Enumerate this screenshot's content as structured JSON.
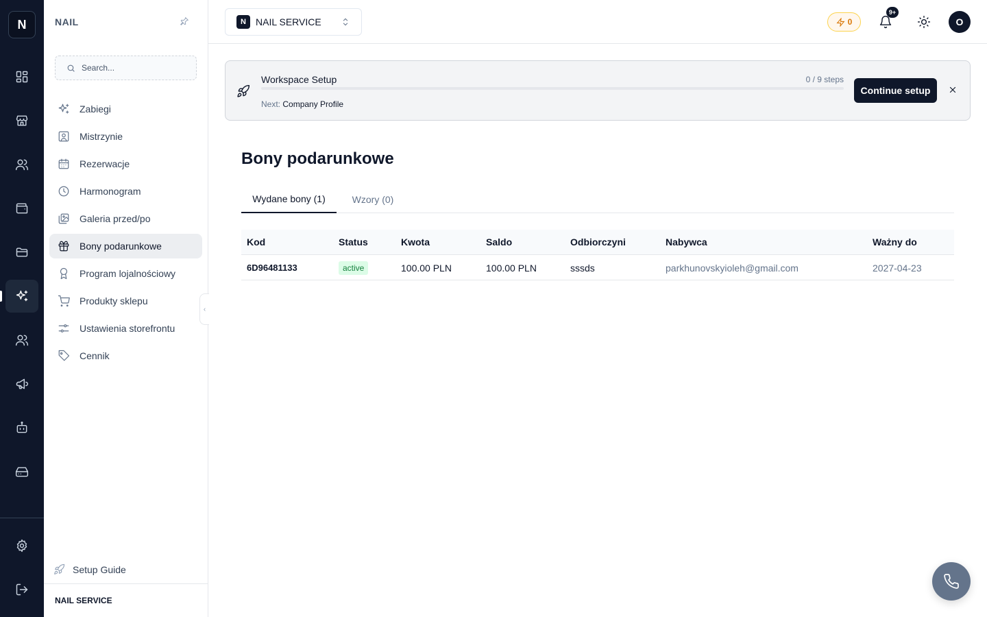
{
  "rail": {
    "logo": "N",
    "items": [
      {
        "icon": "dashboard-icon"
      },
      {
        "icon": "store-icon"
      },
      {
        "icon": "users-icon"
      },
      {
        "icon": "wallet-icon"
      },
      {
        "icon": "folder-icon"
      },
      {
        "icon": "sparkles-icon",
        "active": true
      },
      {
        "icon": "team-icon"
      },
      {
        "icon": "megaphone-icon"
      },
      {
        "icon": "bot-icon"
      },
      {
        "icon": "hard-drive-icon"
      }
    ],
    "bottom": [
      {
        "icon": "settings-icon"
      },
      {
        "icon": "logout-icon"
      }
    ]
  },
  "sidebar": {
    "title": "NAIL",
    "search_placeholder": "Search...",
    "items": [
      {
        "label": "Zabiegi",
        "icon": "sparkles-icon"
      },
      {
        "label": "Mistrzynie",
        "icon": "user-square-icon"
      },
      {
        "label": "Rezerwacje",
        "icon": "calendar-icon"
      },
      {
        "label": "Harmonogram",
        "icon": "clock-icon"
      },
      {
        "label": "Galeria przed/po",
        "icon": "images-icon"
      },
      {
        "label": "Bony podarunkowe",
        "icon": "gift-icon",
        "active": true
      },
      {
        "label": "Program lojalnościowy",
        "icon": "award-icon"
      },
      {
        "label": "Produkty sklepu",
        "icon": "cart-icon"
      },
      {
        "label": "Ustawienia storefrontu",
        "icon": "sliders-icon"
      },
      {
        "label": "Cennik",
        "icon": "tag-icon"
      }
    ],
    "setup_guide": "Setup Guide",
    "footer": "NAIL SERVICE"
  },
  "topbar": {
    "workspace_badge": "N",
    "workspace_name": "NAIL SERVICE",
    "credits": "0",
    "notifications_badge": "9+",
    "avatar": "O"
  },
  "banner": {
    "title": "Workspace Setup",
    "next_label": "Next:",
    "next_value": "Company Profile",
    "steps": "0 / 9 steps",
    "progress": 0,
    "continue": "Continue setup"
  },
  "page": {
    "title": "Bony podarunkowe",
    "tabs": [
      {
        "label": "Wydane bony (1)",
        "active": true
      },
      {
        "label": "Wzory (0)",
        "active": false
      }
    ]
  },
  "table": {
    "headers": [
      "Kod",
      "Status",
      "Kwota",
      "Saldo",
      "Odbiorczyni",
      "Nabywca",
      "Ważny do"
    ],
    "rows": [
      {
        "kod": "6D96481133",
        "status": "active",
        "kwota": "100.00 PLN",
        "saldo": "100.00 PLN",
        "odbiorczyni": "sssds",
        "nabywca": "parkhunovskyioleh@gmail.com",
        "wazny_do": "2027-04-23"
      }
    ]
  },
  "colors": {
    "rail_bg": "#0f172a",
    "primary": "#0f172a",
    "status_active_bg": "#dcfce7",
    "status_active_text": "#15803d",
    "credits": "#d97706"
  }
}
